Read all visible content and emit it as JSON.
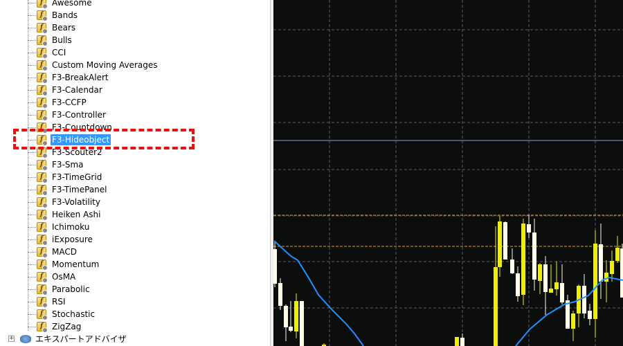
{
  "navigator": {
    "indicators": [
      {
        "label": "Awesome"
      },
      {
        "label": "Bands"
      },
      {
        "label": "Bears"
      },
      {
        "label": "Bulls"
      },
      {
        "label": "CCI"
      },
      {
        "label": "Custom Moving Averages"
      },
      {
        "label": "F3-BreakAlert"
      },
      {
        "label": "F3-Calendar"
      },
      {
        "label": "F3-CCFP"
      },
      {
        "label": "F3-Controller"
      },
      {
        "label": "F3-Countdown"
      },
      {
        "label": "F3-Hideobject",
        "selected": true
      },
      {
        "label": "F3-Scouter2"
      },
      {
        "label": "F3-Sma"
      },
      {
        "label": "F3-TimeGrid"
      },
      {
        "label": "F3-TimePanel"
      },
      {
        "label": "F3-Volatility"
      },
      {
        "label": "Heiken Ashi"
      },
      {
        "label": "Ichimoku"
      },
      {
        "label": "iExposure"
      },
      {
        "label": "MACD"
      },
      {
        "label": "Momentum"
      },
      {
        "label": "OsMA"
      },
      {
        "label": "Parabolic"
      },
      {
        "label": "RSI"
      },
      {
        "label": "Stochastic"
      },
      {
        "label": "ZigZag"
      }
    ],
    "expert_advisors": {
      "label": "エキスパートアドバイザ",
      "expand_symbol": "+"
    },
    "indicator_icon_glyph": "f"
  },
  "chart": {
    "background": "#0c0e0e",
    "bull_color": "#eeee00",
    "bear_color": "#fffde8",
    "ma_color": "#1e90ff",
    "grid_color": "#5a5a6a",
    "level_color": "#e8a020",
    "hline_color": "#7aa6d6"
  },
  "annotation": {
    "color": "#e81010"
  }
}
